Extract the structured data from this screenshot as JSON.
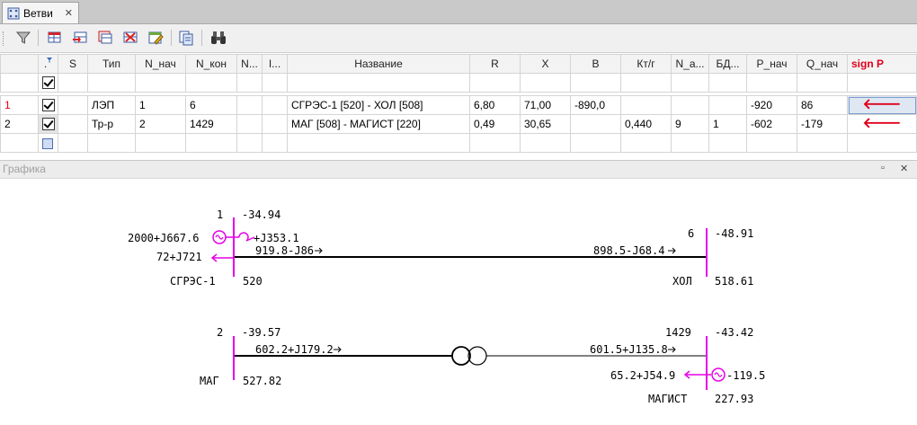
{
  "tab": {
    "title": "Ветви",
    "close": "✕"
  },
  "grid": {
    "headers": [
      ".",
      "S",
      "Тип",
      "N_нач",
      "N_кон",
      "N...",
      "I...",
      "Название",
      "R",
      "X",
      "B",
      "Кт/г",
      "N_a...",
      "БД...",
      "P_нач",
      "Q_нач",
      "sign P"
    ],
    "rows": [
      {
        "num": "1",
        "type": "ЛЭП",
        "n_start": "1",
        "n_end": "6",
        "n_par": "",
        "i": "",
        "name": "СГРЭС-1 [520] - ХОЛ [508]",
        "r": "6,80",
        "x": "71,00",
        "b": "-890,0",
        "kt": "",
        "na": "",
        "bd": "",
        "p": "-920",
        "q": "86"
      },
      {
        "num": "2",
        "type": "Тр-р",
        "n_start": "2",
        "n_end": "1429",
        "n_par": "",
        "i": "",
        "name": "МАГ [508] - МАГИСТ [220]",
        "r": "0,49",
        "x": "30,65",
        "b": "",
        "kt": "0,440",
        "na": "9",
        "bd": "1",
        "p": "-602",
        "q": "-179"
      }
    ]
  },
  "panel": {
    "title": "Графика"
  },
  "diagram": {
    "b1": {
      "node_start": "1",
      "val_start": "-34.94",
      "name_start": "СГРЭС-1",
      "volt_start": "520",
      "gen": "2000+J667.6",
      "shunt": "+J353.1",
      "load": "72+J721",
      "flow_start": "919.8-J86",
      "node_end": "6",
      "val_end": "-48.91",
      "name_end": "ХОЛ",
      "volt_end": "518.61",
      "flow_end": "898.5-J68.4"
    },
    "b2": {
      "node_start": "2",
      "val_start": "-39.57",
      "name_start": "МАГ",
      "volt_start": "527.82",
      "flow_start": "602.2+J179.2",
      "node_end": "1429",
      "val_end": "-43.42",
      "name_end": "МАГИСТ",
      "volt_end": "227.93",
      "flow_end": "601.5+J135.8",
      "load": "65.2+J54.9",
      "gen_val": "-119.5"
    },
    "colors": {
      "bus": "#e600e6",
      "line": "#000000"
    }
  }
}
